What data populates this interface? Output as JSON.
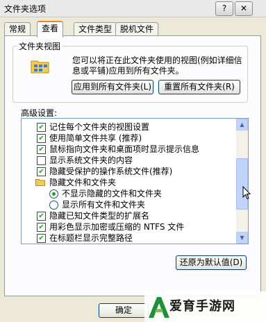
{
  "window": {
    "title": "文件夹选项",
    "help_label": "?",
    "close_label": "✕"
  },
  "tabs": [
    {
      "label": "常规"
    },
    {
      "label": "查看",
      "active": true
    },
    {
      "label": "文件类型"
    },
    {
      "label": "脱机文件"
    }
  ],
  "folder_views": {
    "legend": "文件夹视图",
    "description": "您可以将正在此文件夹使用的视图(例如详细信息或平铺)应用到所有文件夹。",
    "apply_all_label": "应用到所有文件夹(L)",
    "reset_all_label": "重置所有文件夹(R)"
  },
  "advanced": {
    "label": "高级设置:",
    "items": [
      {
        "type": "checkbox",
        "checked": true,
        "label": "记住每个文件夹的视图设置"
      },
      {
        "type": "checkbox",
        "checked": true,
        "label": "使用简单文件共享 (推荐)"
      },
      {
        "type": "checkbox",
        "checked": true,
        "label": "鼠标指向文件夹和桌面项时显示提示信息"
      },
      {
        "type": "checkbox",
        "checked": false,
        "label": "显示系统文件夹的内容"
      },
      {
        "type": "checkbox",
        "checked": true,
        "label": "隐藏受保护的操作系统文件(推荐)"
      },
      {
        "type": "folder",
        "label": "隐藏文件和文件夹"
      },
      {
        "type": "radio",
        "checked": true,
        "label": "不显示隐藏的文件和文件夹"
      },
      {
        "type": "radio",
        "checked": false,
        "label": "显示所有文件和文件夹"
      },
      {
        "type": "checkbox",
        "checked": true,
        "label": "隐藏已知文件类型的扩展名"
      },
      {
        "type": "checkbox",
        "checked": true,
        "label": "用彩色显示加密或压缩的 NTFS 文件"
      },
      {
        "type": "checkbox",
        "checked": true,
        "label": "在标题栏显示完整路径"
      }
    ],
    "restore_defaults_label": "还原为默认值(D)"
  },
  "footer": {
    "ok_label": "确定"
  },
  "watermark": {
    "text": "爱育手游网"
  },
  "colors": {
    "check": "#21a121",
    "tab_highlight": "#e68b2c",
    "scrollbar": "#c1d3fb"
  }
}
